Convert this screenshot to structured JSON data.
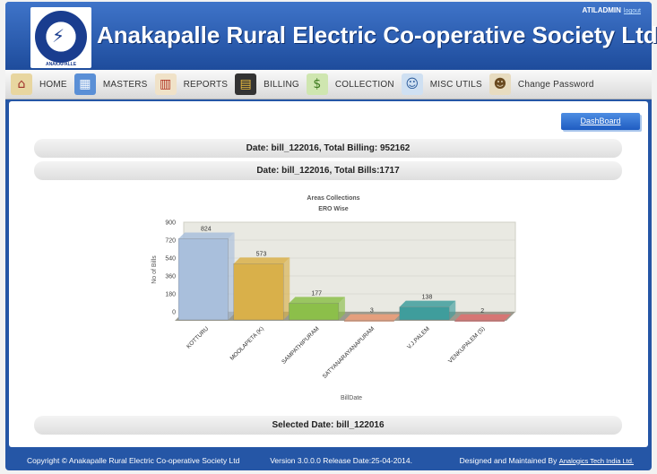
{
  "header": {
    "title": "Anakapalle Rural Electric Co-operative Society Ltd",
    "user": "ATILADMIN",
    "logout": "logout",
    "logo_text": "ANAKAPALLE"
  },
  "nav": [
    {
      "label": "HOME",
      "icon": "home-icon"
    },
    {
      "label": "MASTERS",
      "icon": "calendar-icon"
    },
    {
      "label": "REPORTS",
      "icon": "report-icon"
    },
    {
      "label": "BILLING",
      "icon": "billing-icon"
    },
    {
      "label": "COLLECTION",
      "icon": "money-icon"
    },
    {
      "label": "MISC UTILS",
      "icon": "users-icon"
    },
    {
      "label": "Change Password",
      "icon": "user-key-icon"
    }
  ],
  "main": {
    "dashboard_button": "DashBoard",
    "summary_billing": "Date: bill_122016, Total Billing: 952162",
    "summary_bills": "Date: bill_122016, Total Bills:1717",
    "selected_date": "Selected Date: bill_122016"
  },
  "chart_data": {
    "type": "bar",
    "title": "Areas Collections",
    "subtitle": "ERO Wise",
    "xlabel": "BillDate",
    "ylabel": "No of Bills",
    "ylim": [
      0,
      900
    ],
    "yticks": [
      0,
      180,
      360,
      540,
      720,
      900
    ],
    "categories": [
      "KOTTURU",
      "MOOLAPETA (K)",
      "SAMPATHIPURAM",
      "SATYANARAYANAPURAM",
      "V.J.PALEM",
      "VENKUPALEM (S)"
    ],
    "values": [
      824,
      573,
      177,
      3,
      138,
      2
    ],
    "colors": [
      "#a9bfdc",
      "#d9b04a",
      "#8cbf4a",
      "#f1a07a",
      "#3f9d9c",
      "#e07070"
    ]
  },
  "footer": {
    "copyright": "Copyright © Anakapalle Rural Electric Co-operative Society Ltd",
    "version": "Version 3.0.0.0 Release Date:25-04-2014.",
    "maintained": "Designed and Maintained By",
    "company": "Analogics Tech India Ltd."
  }
}
